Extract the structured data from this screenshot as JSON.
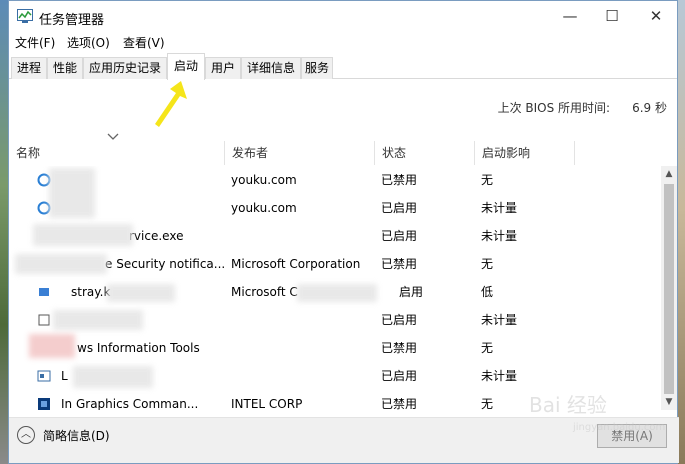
{
  "window": {
    "title": "任务管理器"
  },
  "window_controls": {
    "minimize": "—",
    "maximize": "☐",
    "close": "✕"
  },
  "menu": [
    "文件(F)",
    "选项(O)",
    "查看(V)"
  ],
  "tabs": [
    "进程",
    "性能",
    "应用历史记录",
    "启动",
    "用户",
    "详细信息",
    "服务"
  ],
  "active_tab": "启动",
  "bios": {
    "label": "上次 BIOS 所用时间:",
    "value": "6.9 秒"
  },
  "columns": [
    "名称",
    "发布者",
    "状态",
    "启动影响"
  ],
  "rows": [
    {
      "name": "",
      "publisher": "youku.com",
      "status": "已禁用",
      "impact": "无",
      "icon": "blue-circle-icon"
    },
    {
      "name": "",
      "publisher": "youku.com",
      "status": "已启用",
      "impact": "未计量",
      "icon": "blue-circle-icon"
    },
    {
      "name": "rvice.exe",
      "publisher": "",
      "status": "已启用",
      "impact": "未计量",
      "icon": ""
    },
    {
      "name": "e Security notifica...",
      "publisher": "Microsoft Corporation",
      "status": "已禁用",
      "impact": "无",
      "icon": ""
    },
    {
      "name": "stray.k",
      "publisher": "Microsoft C",
      "status": "启用",
      "impact": "低",
      "icon": "app-icon"
    },
    {
      "name": "",
      "publisher": "",
      "status": "已启用",
      "impact": "未计量",
      "icon": "app-icon"
    },
    {
      "name": "ws Information Tools",
      "publisher": "",
      "status": "已禁用",
      "impact": "无",
      "icon": ""
    },
    {
      "name": "L",
      "publisher": "",
      "status": "已启用",
      "impact": "未计量",
      "icon": "window-icon"
    },
    {
      "name": "In  Graphics Comman...",
      "publisher": "INTEL CORP",
      "status": "已禁用",
      "impact": "无",
      "icon": "intel-graphics-icon"
    }
  ],
  "footer": {
    "fewer_details": "简略信息(D)",
    "disable_button": "禁用(A)"
  },
  "watermark": {
    "brand": "Bai 经验",
    "url": "jingyan.baidu.com"
  },
  "colors": {
    "accent_arrow": "#f5e51a",
    "window_border": "#7a9cc0"
  }
}
